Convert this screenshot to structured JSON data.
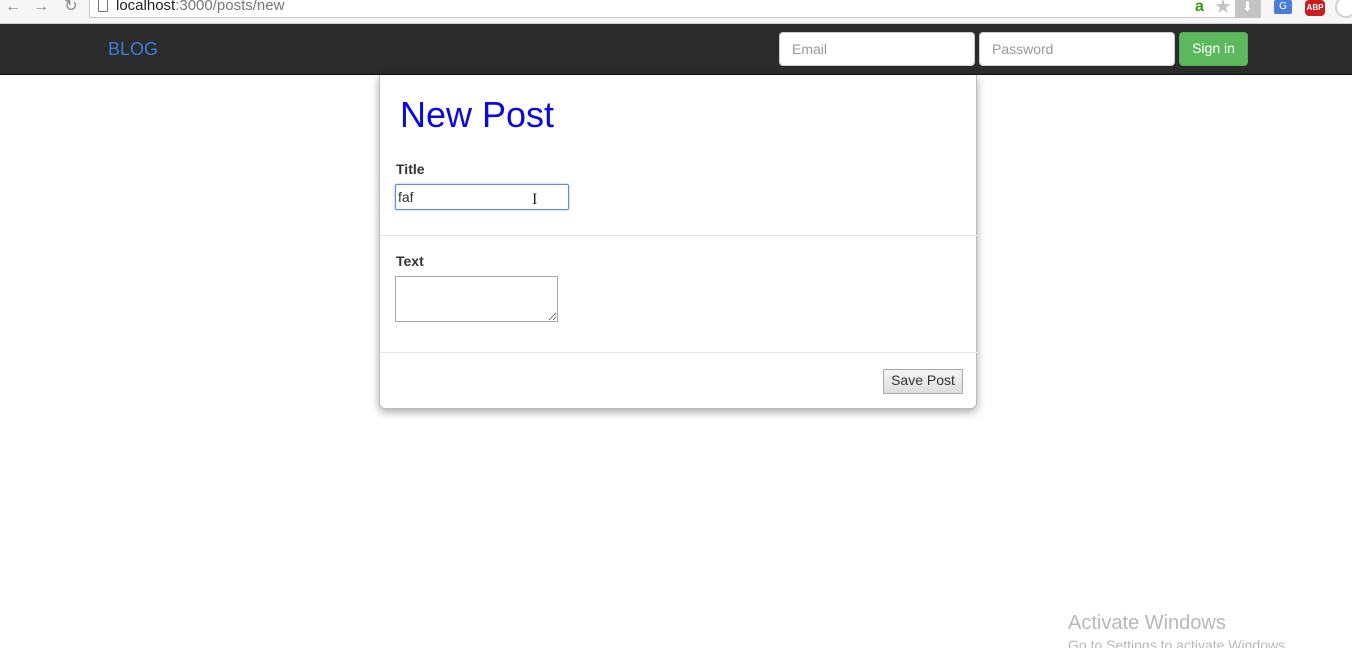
{
  "browser": {
    "back_icon": "←",
    "forward_icon": "→",
    "reload_icon": "↻",
    "url_host": "localhost",
    "url_rest": ":3000/posts/new",
    "extensions": {
      "amazon": "a",
      "star": "★",
      "download": "⬇",
      "translate": "G",
      "adblock": "ABP"
    }
  },
  "navbar": {
    "brand": "BLOG",
    "email_placeholder": "Email",
    "password_placeholder": "Password",
    "signin_label": "Sign in",
    "signin_color": "#5cb85c"
  },
  "form": {
    "heading": "New Post",
    "heading_color": "#0a0adb",
    "title_label": "Title",
    "title_value": "faf",
    "text_label": "Text",
    "text_value": "",
    "save_label": "Save Post"
  },
  "cursor": "I",
  "watermark": {
    "line1": "Activate Windows",
    "line2": "Go to Settings to activate Windows."
  }
}
